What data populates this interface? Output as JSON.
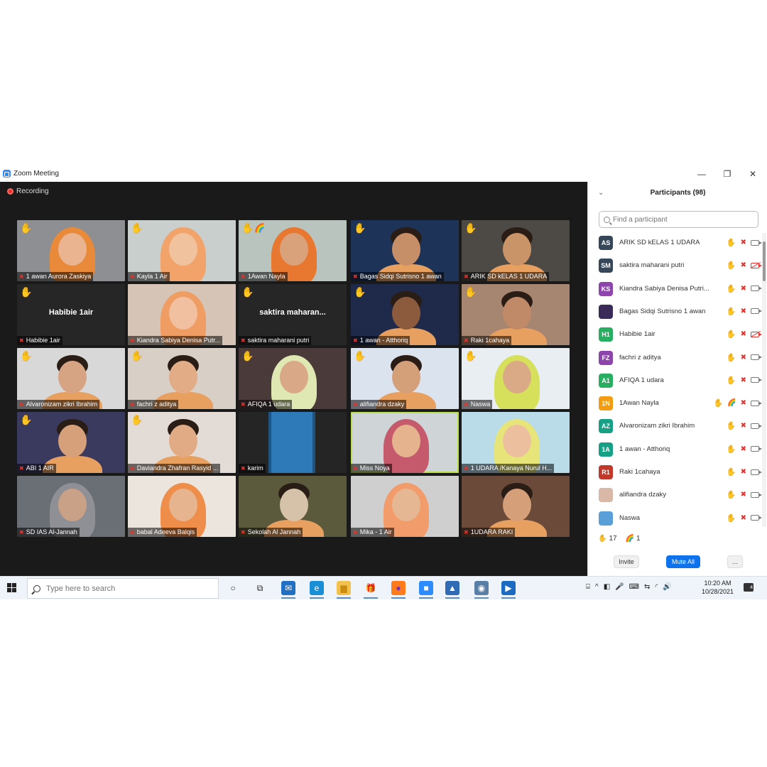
{
  "window": {
    "title": "Zoom Meeting",
    "recording_label": "Recording",
    "minimize": "—",
    "restore": "❐",
    "close": "✕"
  },
  "tiles": [
    {
      "name": "1 awan Aurora Zaskiya",
      "hand": "✋",
      "hand_style": "yellow",
      "bg": "#8d8f92",
      "skin": "#e9b48f",
      "hijab": "#e88a3a"
    },
    {
      "name": "Kayla 1 Air",
      "hand": "✋",
      "hand_style": "pale",
      "bg": "#c9cfcc",
      "skin": "#f0c29d",
      "hijab": "#f2a36a"
    },
    {
      "name": "1Awan Nayla",
      "hand": "✋",
      "hand_style": "yellow",
      "extra": "🌈",
      "bg": "#b9c4be",
      "skin": "#d9a27a",
      "hijab": "#e8782f"
    },
    {
      "name": "Bagas Sidqi Sutrisno 1 awan",
      "hand": "✋",
      "hand_style": "yellow",
      "bg": "#1d3458",
      "skin": "#c78f67",
      "hijab": ""
    },
    {
      "name": "ARIK   SD kELAS 1 UDARA",
      "hand": "✋",
      "hand_style": "pale",
      "bg": "#4d4a45",
      "skin": "#c99468",
      "hijab": ""
    },
    {
      "name": "Habibie  1air",
      "hand": "✋",
      "hand_style": "pale",
      "bg": "#262626",
      "big_name": "Habibie  1air"
    },
    {
      "name": "Kiandra Sabiya Denisa Putr...",
      "hand": "",
      "hand_style": "yellow",
      "bg": "#d6c5b6",
      "skin": "#f0c0a0",
      "hijab": "#ef9d63"
    },
    {
      "name": "saktira maharani putri",
      "hand": "✋",
      "hand_style": "yellow",
      "bg": "#262626",
      "big_name": "saktira  maharan..."
    },
    {
      "name": "1 awan - Atthoriq",
      "hand": "✋",
      "hand_style": "yellow",
      "bg": "#1f2a4a",
      "skin": "#8c5a3c",
      "hijab": ""
    },
    {
      "name": "Raki 1cahaya",
      "hand": "✋",
      "hand_style": "yellow",
      "bg": "#a68670",
      "skin": "#c08a68",
      "hijab": ""
    },
    {
      "name": "Alvaronizam zikri Ibrahim",
      "hand": "✋",
      "hand_style": "yellow",
      "bg": "#d8d8d8",
      "skin": "#d6a383",
      "hijab": ""
    },
    {
      "name": "fachri z aditya",
      "hand": "✋",
      "hand_style": "pale",
      "bg": "#d8cfc6",
      "skin": "#e2ad86",
      "hijab": ""
    },
    {
      "name": "AFIQA 1 udara",
      "hand": "✋",
      "hand_style": "yellow",
      "bg": "#4a3a3a",
      "skin": "#d9a887",
      "hijab": "#dfe8b2"
    },
    {
      "name": "alifiandra dzaky",
      "hand": "✋",
      "hand_style": "pale",
      "bg": "#dbe3ef",
      "skin": "#d4a07a",
      "hijab": ""
    },
    {
      "name": "Naswa",
      "hand": "✋",
      "hand_style": "yellow",
      "bg": "#e9eef2",
      "skin": "#d9aa85",
      "hijab": "#d6e05a"
    },
    {
      "name": "ABI 1 AIR",
      "hand": "✋",
      "hand_style": "pale",
      "bg": "#3a3a5e",
      "skin": "#d6a07a",
      "hijab": ""
    },
    {
      "name": "Daviandra Zhafran Rasyid ...",
      "hand": "✋",
      "hand_style": "yellow",
      "bg": "#e3dcd6",
      "skin": "#e0ab85",
      "hijab": ""
    },
    {
      "name": "karim",
      "hand": "",
      "hand_style": "yellow",
      "bg": "#252525",
      "skin": "",
      "hijab": "",
      "door": true
    },
    {
      "name": "Miss Noya",
      "hand": "",
      "hand_style": "yellow",
      "bg": "#cfd4d6",
      "skin": "#e6b38f",
      "hijab": "#c45a6b",
      "active": true
    },
    {
      "name": "1 UDARA /Kanaya Nurul H...",
      "hand": "",
      "hand_style": "yellow",
      "bg": "#b9dce8",
      "skin": "#ecc09e",
      "hijab": "#e7e47a"
    },
    {
      "name": "SD IAS Al-Jannah",
      "hand": "",
      "hand_style": "yellow",
      "bg": "#6a6e75",
      "skin": "#c9a186",
      "hijab": "#8f8f96"
    },
    {
      "name": "babal Adeeva Balqis",
      "hand": "",
      "hand_style": "yellow",
      "bg": "#ece5dd",
      "skin": "#e6b48e",
      "hijab": "#ef8d4b"
    },
    {
      "name": "Sekolah Al Jannah",
      "hand": "",
      "hand_style": "yellow",
      "bg": "#5c5a3c",
      "skin": "#d6c2a8",
      "hijab": ""
    },
    {
      "name": "Mika - 1 Air",
      "hand": "",
      "hand_style": "yellow",
      "bg": "#cfcfcf",
      "skin": "#e6b793",
      "hijab": "#f39c6b"
    },
    {
      "name": "1UDARA RAKI",
      "hand": "",
      "hand_style": "yellow",
      "bg": "#6b4a3a",
      "skin": "#d59f7a",
      "hijab": ""
    }
  ],
  "panel": {
    "title": "Participants (98)",
    "search_placeholder": "Find a participant",
    "participants": [
      {
        "initials": "AS",
        "name": "ARIK   SD kELAS 1 UDARA",
        "color": "#37475a",
        "hand": "✋",
        "hand_style": "pale",
        "cam_off": false
      },
      {
        "initials": "SM",
        "name": "saktira maharani putri",
        "color": "#37475a",
        "hand": "✋",
        "hand_style": "yellow",
        "cam_off": true
      },
      {
        "initials": "KS",
        "name": "Kiandra Sabiya Denisa Putri...",
        "color": "#8e44ad",
        "hand": "✋",
        "hand_style": "pale",
        "cam_off": false
      },
      {
        "initials": "",
        "name": "Bagas Sidqi Sutrisno 1 awan",
        "color": "#3a2a5a",
        "hand": "✋",
        "hand_style": "yellow",
        "cam_off": false
      },
      {
        "initials": "H1",
        "name": "Habibie  1air",
        "color": "#27ae60",
        "hand": "✋",
        "hand_style": "pale",
        "cam_off": true
      },
      {
        "initials": "FZ",
        "name": "fachri z aditya",
        "color": "#8e44ad",
        "hand": "✋",
        "hand_style": "pale",
        "cam_off": false
      },
      {
        "initials": "A1",
        "name": "AFIQA 1 udara",
        "color": "#27ae60",
        "hand": "✋",
        "hand_style": "yellow",
        "cam_off": false
      },
      {
        "initials": "1N",
        "name": "1Awan Nayla",
        "color": "#f39c12",
        "hand": "✋",
        "hand_style": "yellow",
        "extra": "🌈",
        "cam_off": false
      },
      {
        "initials": "AZ",
        "name": "Alvaronizam zikri Ibrahim",
        "color": "#16a085",
        "hand": "✋",
        "hand_style": "yellow",
        "cam_off": false
      },
      {
        "initials": "1A",
        "name": "1 awan - Atthoriq",
        "color": "#16a085",
        "hand": "✋",
        "hand_style": "yellow",
        "cam_off": false
      },
      {
        "initials": "R1",
        "name": "Raki 1cahaya",
        "color": "#c0392b",
        "hand": "✋",
        "hand_style": "yellow",
        "cam_off": false
      },
      {
        "initials": "",
        "name": "alifiandra dzaky",
        "color": "#d9b8a8",
        "hand": "✋",
        "hand_style": "pale",
        "cam_off": false
      },
      {
        "initials": "",
        "name": "Naswa",
        "color": "#5aa0d8",
        "hand": "✋",
        "hand_style": "yellow",
        "cam_off": false
      }
    ],
    "reactions": [
      {
        "icon": "✋",
        "count": "17"
      },
      {
        "icon": "🌈",
        "count": "1"
      }
    ],
    "invite_label": "Invite",
    "mute_all_label": "Mute All",
    "more_label": "..."
  },
  "taskbar": {
    "search_placeholder": "Type here to search",
    "icons": [
      {
        "name": "cortana-icon",
        "glyph": "○",
        "color": "transparent",
        "fg": "#222"
      },
      {
        "name": "task-view-icon",
        "glyph": "⧉",
        "color": "transparent",
        "fg": "#222"
      },
      {
        "name": "mail-icon",
        "glyph": "✉",
        "color": "#1f6fc5",
        "fg": "#fff"
      },
      {
        "name": "edge-icon",
        "glyph": "e",
        "color": "#1b8fd6",
        "fg": "#fff"
      },
      {
        "name": "file-explorer-icon",
        "glyph": "▆",
        "color": "#f2c14e",
        "fg": "#c98b10"
      },
      {
        "name": "gift-icon",
        "glyph": "🎁",
        "color": "transparent",
        "fg": "#c0392b"
      },
      {
        "name": "firefox-icon",
        "glyph": "●",
        "color": "#ff7a1a",
        "fg": "#7b2fb5"
      },
      {
        "name": "zoom-icon",
        "glyph": "■",
        "color": "#2d8cff",
        "fg": "#fff"
      },
      {
        "name": "photos-icon",
        "glyph": "▲",
        "color": "#2f6cb5",
        "fg": "#fff"
      },
      {
        "name": "camera-icon",
        "glyph": "◉",
        "color": "#5a7fa6",
        "fg": "#fff"
      },
      {
        "name": "media-player-icon",
        "glyph": "▶",
        "color": "#1c6bc2",
        "fg": "#fff"
      }
    ],
    "tray": [
      "⌸",
      "^",
      "◧",
      "🎤",
      "⌨",
      "⇆",
      "◜",
      "🔊"
    ],
    "time": "10:20 AM",
    "date": "10/28/2021",
    "notification_count": "4"
  }
}
